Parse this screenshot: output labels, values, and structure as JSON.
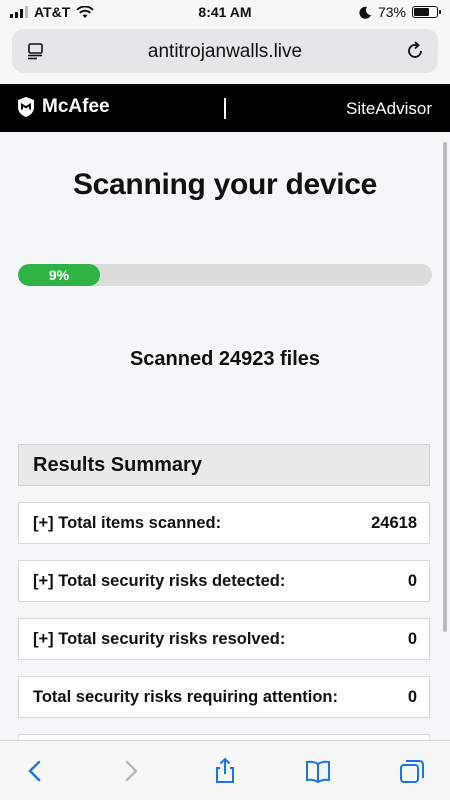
{
  "status_bar": {
    "carrier": "AT&T",
    "time": "8:41 AM",
    "battery_percent": "73%",
    "battery_level": 0.73,
    "icons": [
      "signal-icon",
      "wifi-icon",
      "moon-icon",
      "battery-icon"
    ]
  },
  "address_bar": {
    "url": "antitrojanwalls.live",
    "icons": [
      "reader-icon",
      "reload-icon"
    ]
  },
  "header": {
    "logo_text": "McAfee",
    "right_text": "SiteAdvisor"
  },
  "main": {
    "title": "Scanning your device",
    "progress": {
      "label": "9%",
      "value": 0.09
    },
    "scanned_text": "Scanned 24923 files"
  },
  "summary": {
    "heading": "Results Summary",
    "rows": [
      {
        "label": "[+] Total items scanned:",
        "value": "24618"
      },
      {
        "label": "[+] Total security risks detected:",
        "value": "0"
      },
      {
        "label": "[+] Total security risks resolved:",
        "value": "0"
      },
      {
        "label": "Total security risks requiring attention:",
        "value": "0"
      }
    ]
  },
  "toolbar": {
    "icons": [
      "back-icon",
      "forward-icon",
      "share-icon",
      "bookmarks-icon",
      "tabs-icon"
    ]
  },
  "colors": {
    "progress_fill": "#2fb345",
    "header_bg": "#000000",
    "link_blue": "#1a73e8"
  }
}
